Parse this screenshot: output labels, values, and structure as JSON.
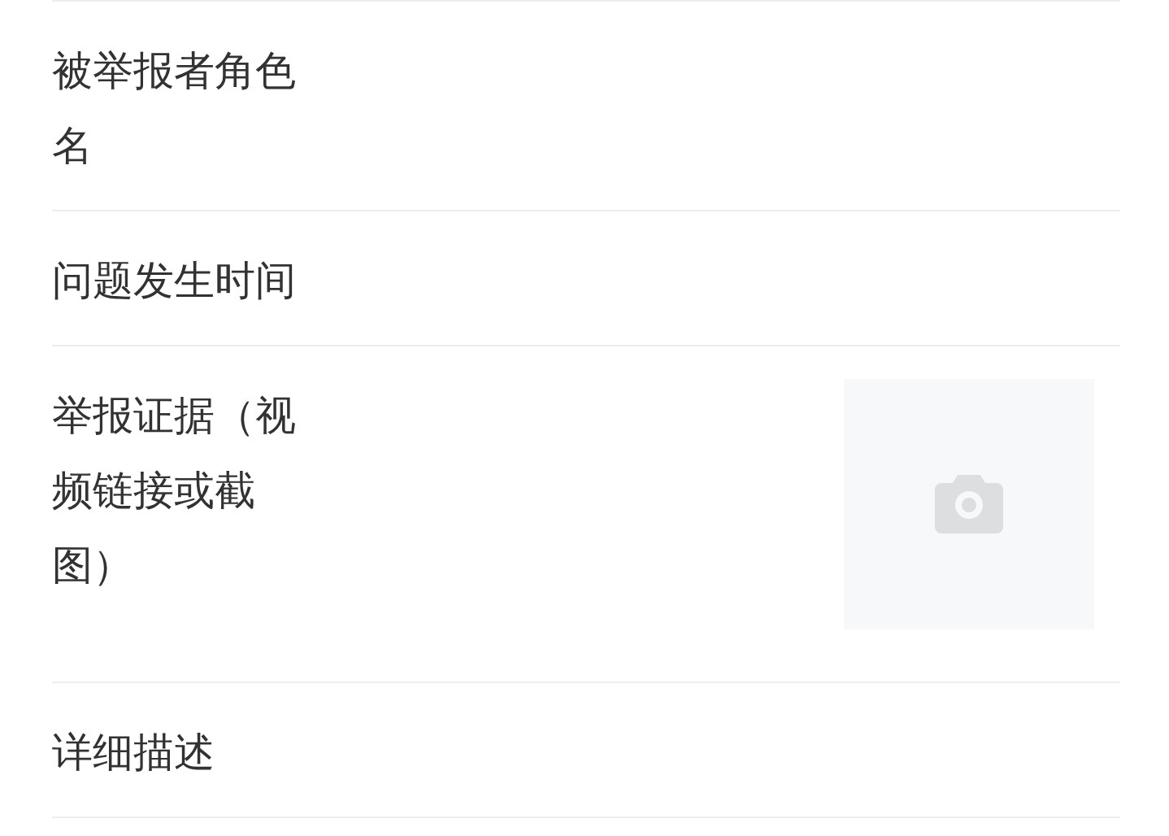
{
  "fields": [
    {
      "label": "被举报者角色名",
      "kind": "text"
    },
    {
      "label": "问题发生时间",
      "kind": "text"
    },
    {
      "label": "举报证据（视频链接或截图）",
      "kind": "upload"
    },
    {
      "label": "详细描述",
      "kind": "text"
    }
  ]
}
